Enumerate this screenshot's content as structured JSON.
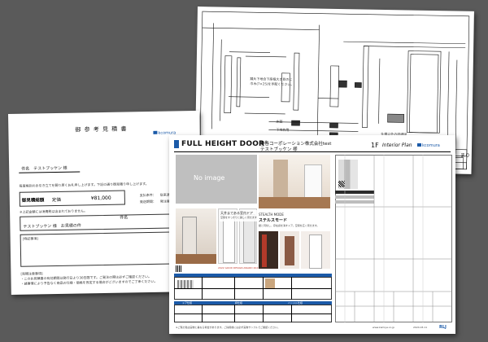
{
  "drawing": {
    "notes": [
      "錆片下地合下座框大き目のに",
      "巾木(7×25)を手配ください。"
    ],
    "labels": [
      "D1",
      "床面",
      "下地枠用",
      "天井受枠",
      "天井受枠",
      "壁材",
      "床面"
    ],
    "bottom_note": "仕様以外の詳細図",
    "bottom_right": "まり",
    "brand": "RLJ"
  },
  "estimate": {
    "title": "御 参 考 見 積 書",
    "brand": "kcomura",
    "addressee_label": "件名",
    "addressee": "テストブッケン 様",
    "intro": "毎度格別のお引き立てを賜り厚くお礼申し上げます。下記の通り御見積り申し上げます。",
    "amount_label": "御見積総額",
    "amount_tax": "定価",
    "amount_value": "¥81,000",
    "terms": [
      "支払条件：",
      "発送期間："
    ],
    "term_values": [
      "従来通り",
      "発注確認後"
    ],
    "tax_note": "※上記金額には消費税は含まれておりません。",
    "subject_label": "件名",
    "subject_value": "テストブッケン 様　お見積の件",
    "remarks_label": "[特記事項]",
    "footer_label": "[見積注意事項]",
    "footer_lines": [
      "・このお見積書の有効期間は発行日より30日間です。ご発注の際は必ずご確認ください。",
      "・諸事情により予告なく商品の仕様・価格を改定する場合がございますのでご了承ください。"
    ]
  },
  "plan": {
    "logo": "FULL HEIGHT DOOR",
    "logo_tm": "®",
    "company": "神谷コーポレーション株式会社test",
    "project": "テストブッケン 様",
    "floor": "1F",
    "plan_label": "Interior Plan",
    "brand": "kcomura",
    "no_image": "No image",
    "catch1": "天井まである室内ドア",
    "catch2": "空間をすっきりと美しく見せます",
    "stealth_label": "STEALTH MODE",
    "stealth_jp": "ステルスモード",
    "stealth_desc": "壁と同化し、存在感を消すドア。空間を広く見せます。",
    "award": "2022 GOOD DESIGN AWARD 2021",
    "footer_note": "※ご覧の色は実物と異なる場合があります。ご採用前には必ず実物サンプルでご確認ください。",
    "footer_url": "www.kamiya.co.jp",
    "footer_date": "2024.03.11",
    "footer_brand": "RLJ",
    "spec_labels": [
      "ドア仕様",
      "枠仕様",
      "ハンドル仕様"
    ],
    "table_headers": [
      "品番",
      "色",
      "サイズ",
      "ハンドル",
      "備考"
    ]
  }
}
